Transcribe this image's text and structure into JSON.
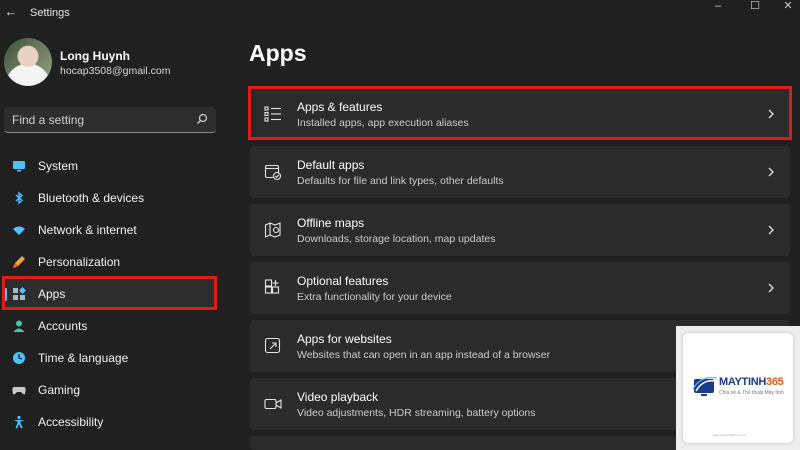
{
  "window": {
    "title": "Settings",
    "controls": {
      "minimize": "–",
      "maximize": "☐",
      "close": "✕"
    }
  },
  "profile": {
    "name": "Long Huynh",
    "email": "hocap3508@gmail.com"
  },
  "search": {
    "placeholder": "Find a setting",
    "icon": "search-icon"
  },
  "sidebar": {
    "items": [
      {
        "label": "System",
        "icon": "monitor-icon",
        "selected": false
      },
      {
        "label": "Bluetooth & devices",
        "icon": "bluetooth-icon",
        "selected": false
      },
      {
        "label": "Network & internet",
        "icon": "wifi-icon",
        "selected": false
      },
      {
        "label": "Personalization",
        "icon": "brush-icon",
        "selected": false
      },
      {
        "label": "Apps",
        "icon": "apps-icon",
        "selected": true
      },
      {
        "label": "Accounts",
        "icon": "person-icon",
        "selected": false
      },
      {
        "label": "Time & language",
        "icon": "globe-clock-icon",
        "selected": false
      },
      {
        "label": "Gaming",
        "icon": "gamepad-icon",
        "selected": false
      },
      {
        "label": "Accessibility",
        "icon": "accessibility-icon",
        "selected": false
      }
    ]
  },
  "main": {
    "title": "Apps",
    "cards": [
      {
        "title": "Apps & features",
        "subtitle": "Installed apps, app execution aliases",
        "icon": "apps-list-icon",
        "highlighted": true
      },
      {
        "title": "Default apps",
        "subtitle": "Defaults for file and link types, other defaults",
        "icon": "default-apps-icon",
        "highlighted": false
      },
      {
        "title": "Offline maps",
        "subtitle": "Downloads, storage location, map updates",
        "icon": "map-icon",
        "highlighted": false
      },
      {
        "title": "Optional features",
        "subtitle": "Extra functionality for your device",
        "icon": "add-feature-icon",
        "highlighted": false
      },
      {
        "title": "Apps for websites",
        "subtitle": "Websites that can open in an app instead of a browser",
        "icon": "open-link-icon",
        "highlighted": false
      },
      {
        "title": "Video playback",
        "subtitle": "Video adjustments, HDR streaming, battery options",
        "icon": "video-camera-icon",
        "highlighted": false
      }
    ]
  },
  "watermark": {
    "brand_main": "MAYTINH",
    "brand_num": "365",
    "tagline": "Chia sẻ & Thủ thuật Máy tính",
    "footer": "www.maytinh365.com.vn"
  },
  "colors": {
    "background": "#202020",
    "card": "#2b2b2b",
    "accent": "#4cc2ff",
    "highlight_box": "#e11a1a"
  }
}
